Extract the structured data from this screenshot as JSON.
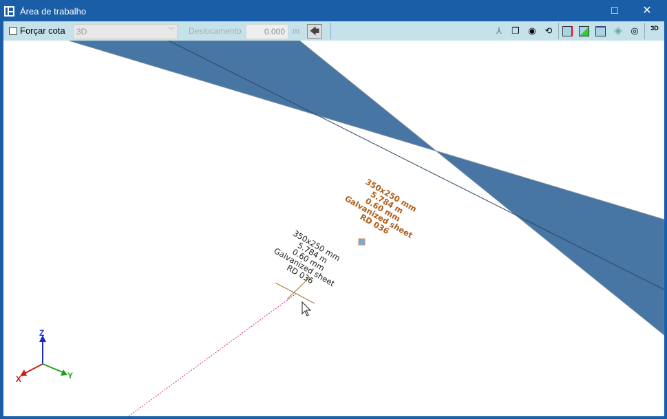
{
  "window": {
    "title": "Área de trabalho",
    "maximize_icon": "□",
    "close_icon": "✕"
  },
  "toolbar": {
    "force_dimension_label": "Forçar cota",
    "force_dimension_checked": false,
    "view_combo_value": "3D",
    "offset_label": "Deslocamento",
    "offset_value": "0.000",
    "offset_unit": "m",
    "back_arrow": "🡄",
    "icons": [
      "axes-icon",
      "cube-icon",
      "orbit-view-icon",
      "rotate-icon",
      "section-red-icon",
      "section-green-icon",
      "section-blue-icon",
      "layers-icon",
      "hide-icon",
      "3d-settings-icon"
    ],
    "threed_label": "3D"
  },
  "duct": {
    "color": "#4776a4"
  },
  "labels": {
    "selected": [
      "350x250 mm",
      "5.784 m",
      "0.60 mm",
      "Galvanized sheet",
      "RD 036"
    ],
    "preview": [
      "350x250 mm",
      "5.784 m",
      "0.60 mm",
      "Galvanized sheet",
      "RD 036"
    ]
  },
  "axes": {
    "x": "X",
    "y": "Y",
    "z": "Z"
  }
}
